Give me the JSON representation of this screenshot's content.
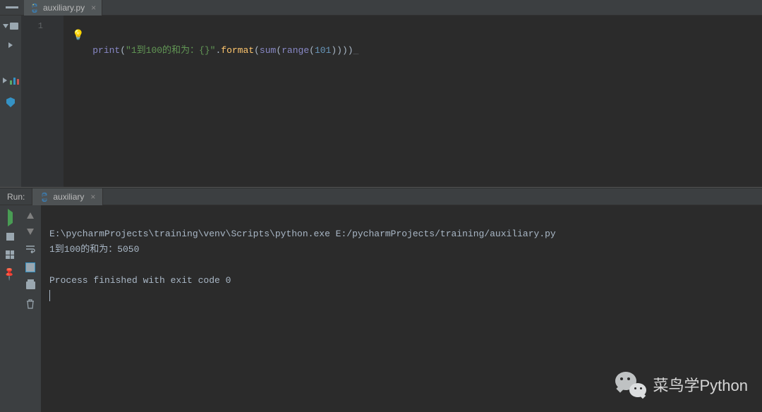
{
  "tab": {
    "filename": "auxiliary.py"
  },
  "editor": {
    "line_number": "1",
    "tokens": {
      "print": "print",
      "lp1": "(",
      "str": "\"1到100的和为：{}\"",
      "dot": ".",
      "format": "format",
      "lp2": "(",
      "sum": "sum",
      "lp3": "(",
      "range": "range",
      "lp4": "(",
      "num": "101",
      "rp": "))))",
      "eol": "_"
    }
  },
  "run": {
    "label": "Run:",
    "tab_name": "auxiliary"
  },
  "console": {
    "line1": "E:\\pycharmProjects\\training\\venv\\Scripts\\python.exe E:/pycharmProjects/training/auxiliary.py",
    "line2": "1到100的和为：5050",
    "blank": "",
    "line3": "Process finished with exit code 0"
  },
  "watermark": {
    "text": "菜鸟学Python"
  }
}
